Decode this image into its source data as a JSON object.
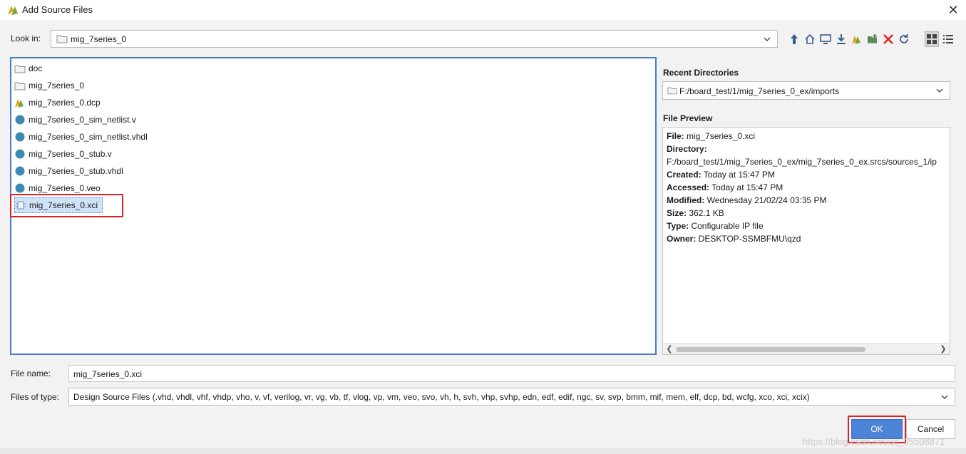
{
  "window": {
    "title": "Add Source Files",
    "close_glyph": "✕"
  },
  "look_in": {
    "label": "Look in:",
    "value": "mig_7series_0"
  },
  "toolbar": {
    "icons": [
      "up-folder-icon",
      "home-icon",
      "desktop-icon",
      "download-icon",
      "project-icon",
      "new-folder-icon",
      "delete-icon",
      "refresh-icon",
      "grid-view-icon",
      "list-view-icon"
    ]
  },
  "files": [
    {
      "name": "doc",
      "icon": "folder-icon"
    },
    {
      "name": "mig_7series_0",
      "icon": "folder-icon"
    },
    {
      "name": "mig_7series_0.dcp",
      "icon": "vivado-icon"
    },
    {
      "name": "mig_7series_0_sim_netlist.v",
      "icon": "source-file-icon"
    },
    {
      "name": "mig_7series_0_sim_netlist.vhdl",
      "icon": "source-file-icon"
    },
    {
      "name": "mig_7series_0_stub.v",
      "icon": "source-file-icon"
    },
    {
      "name": "mig_7series_0_stub.vhdl",
      "icon": "source-file-icon"
    },
    {
      "name": "mig_7series_0.veo",
      "icon": "source-file-icon"
    },
    {
      "name": "mig_7series_0.xci",
      "icon": "ip-core-icon",
      "selected": true
    }
  ],
  "recent": {
    "heading": "Recent Directories",
    "value": "F:/board_test/1/mig_7series_0_ex/imports"
  },
  "preview": {
    "heading": "File Preview",
    "file_label": "File:",
    "file_value": " mig_7series_0.xci",
    "dir_label": "Directory:",
    "dir_value": "F:/board_test/1/mig_7series_0_ex/mig_7series_0_ex.srcs/sources_1/ip",
    "created_label": "Created:",
    "created_value": " Today at 15:47 PM",
    "accessed_label": "Accessed:",
    "accessed_value": " Today at 15:47 PM",
    "modified_label": "Modified:",
    "modified_value": " Wednesday 21/02/24 03:35 PM",
    "size_label": "Size:",
    "size_value": " 362.1 KB",
    "type_label": "Type:",
    "type_value": " Configurable IP file",
    "owner_label": "Owner:",
    "owner_value": " DESKTOP-SSMBFMU\\qzd"
  },
  "file_name": {
    "label": "File name:",
    "value": "mig_7series_0.xci"
  },
  "files_of_type": {
    "label": "Files of type:",
    "value": "Design Source Files (.vhd, vhdl, vhf, vhdp, vho, v, vf, verilog, vr, vg, vb, tf, vlog, vp, vm, veo, svo, vh, h, svh, vhp, svhp, edn, edf, edif, ngc, sv, svp, bmm, mif, mem, elf, dcp, bd, wcfg, xco, xci, xcix)"
  },
  "buttons": {
    "ok": "OK",
    "cancel": "Cancel"
  },
  "watermark": "https://blog.csdn.net/qq_35508871",
  "colors": {
    "accent": "#4b83d6",
    "highlight_box": "#e02020",
    "selection": "#cfe2f8",
    "file_dot": "#3d8bb5"
  }
}
